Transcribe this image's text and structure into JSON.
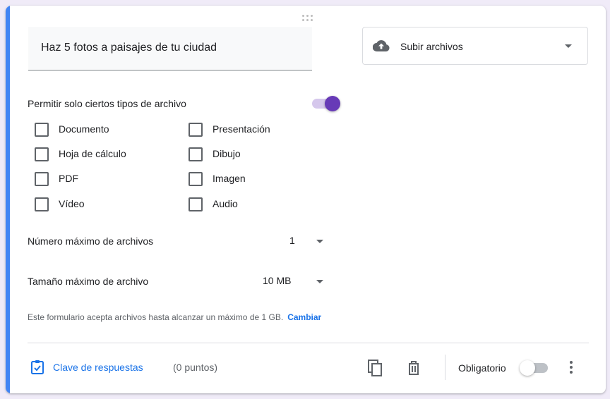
{
  "question": {
    "title": "Haz 5 fotos a paisajes de tu ciudad",
    "type_label": "Subir archivos",
    "type_icon": "cloud-upload-icon"
  },
  "file_types": {
    "label": "Permitir solo ciertos tipos de archivo",
    "enabled": true,
    "options": [
      {
        "label": "Documento",
        "checked": false
      },
      {
        "label": "Presentación",
        "checked": false
      },
      {
        "label": "Hoja de cálculo",
        "checked": false
      },
      {
        "label": "Dibujo",
        "checked": false
      },
      {
        "label": "PDF",
        "checked": false
      },
      {
        "label": "Imagen",
        "checked": false
      },
      {
        "label": "Vídeo",
        "checked": false
      },
      {
        "label": "Audio",
        "checked": false
      }
    ]
  },
  "max_files": {
    "label": "Número máximo de archivos",
    "value": "1"
  },
  "max_size": {
    "label": "Tamaño máximo de archivo",
    "value": "10 MB"
  },
  "limit_note": {
    "text": "Este formulario acepta archivos hasta alcanzar un máximo de 1 GB.",
    "link": "Cambiar"
  },
  "footer": {
    "answer_key_label": "Clave de respuestas",
    "points_label": "(0 puntos)",
    "required_label": "Obligatorio",
    "required": false
  },
  "colors": {
    "accent": "#4285f4",
    "primary": "#673ab7",
    "link": "#1a73e8"
  }
}
